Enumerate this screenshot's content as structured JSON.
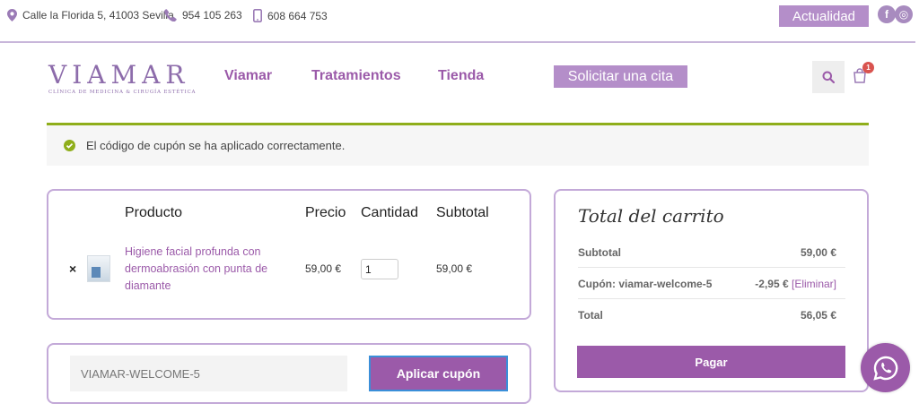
{
  "topbar": {
    "address": "Calle la Florida 5, 41003 Sevilla",
    "phone": "954 105 263",
    "mobile": "608 664 753",
    "actualidad_label": "Actualidad",
    "social": [
      {
        "icon": "facebook-icon",
        "glyph": "f"
      },
      {
        "icon": "instagram-icon",
        "glyph": "◎"
      }
    ]
  },
  "header": {
    "logo_main": "VIAMAR",
    "logo_sub": "CLÍNICA DE MEDICINA & CIRUGÍA ESTÉTICA",
    "nav": [
      "Viamar",
      "Tratamientos",
      "Tienda"
    ],
    "cta_label": "Solicitar una cita",
    "cart_count": "1"
  },
  "notice": {
    "message": "El código de cupón se ha aplicado correctamente."
  },
  "cart": {
    "headers": {
      "product": "Producto",
      "price": "Precio",
      "quantity": "Cantidad",
      "subtotal": "Subtotal"
    },
    "items": [
      {
        "remove_glyph": "×",
        "name": "Higiene facial profunda con dermoabrasión con punta de diamante",
        "price": "59,00 €",
        "quantity": "1",
        "subtotal": "59,00 €"
      }
    ]
  },
  "coupon": {
    "value": "VIAMAR-WELCOME-5",
    "apply_label": "Aplicar cupón"
  },
  "totals": {
    "title": "Total del carrito",
    "subtotal_label": "Subtotal",
    "subtotal_value": "59,00 €",
    "coupon_label": "Cupón: viamar-welcome-5",
    "coupon_value": "-2,95 €",
    "coupon_remove": "[Eliminar]",
    "total_label": "Total",
    "total_value": "56,05 €",
    "checkout_label": "Pagar"
  },
  "colors": {
    "brand_purple": "#9b5aa9",
    "light_purple": "#b48ec9",
    "success_green": "#8fae1b"
  }
}
